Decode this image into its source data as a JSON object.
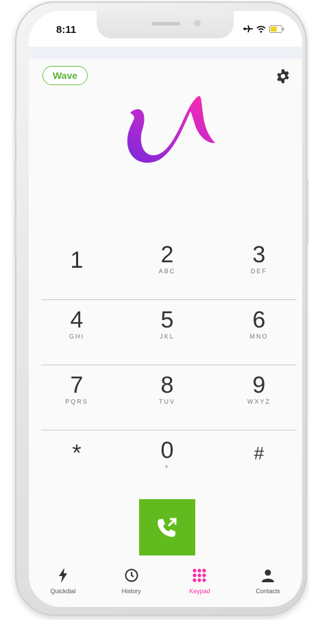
{
  "status_bar": {
    "time": "8:11"
  },
  "header": {
    "wave_button_label": "Wave"
  },
  "keypad": {
    "rows": [
      [
        {
          "digit": "1",
          "letters": ""
        },
        {
          "digit": "2",
          "letters": "ABC"
        },
        {
          "digit": "3",
          "letters": "DEF"
        }
      ],
      [
        {
          "digit": "4",
          "letters": "GHI"
        },
        {
          "digit": "5",
          "letters": "JKL"
        },
        {
          "digit": "6",
          "letters": "MNO"
        }
      ],
      [
        {
          "digit": "7",
          "letters": "PQRS"
        },
        {
          "digit": "8",
          "letters": "TUV"
        },
        {
          "digit": "9",
          "letters": "WXYZ"
        }
      ],
      [
        {
          "digit": "*",
          "letters": ""
        },
        {
          "digit": "0",
          "letters": "+"
        },
        {
          "digit": "#",
          "letters": ""
        }
      ]
    ]
  },
  "tabbar": {
    "items": [
      {
        "label": "Quickdial",
        "icon": "lightning-icon"
      },
      {
        "label": "History",
        "icon": "clock-icon"
      },
      {
        "label": "Keypad",
        "icon": "keypad-grid-icon",
        "active": true
      },
      {
        "label": "Contacts",
        "icon": "person-icon"
      }
    ]
  },
  "colors": {
    "accent_green": "#62bb1e",
    "active_tab_pink": "#ff2aa8",
    "logo_gradient_start": "#8a2be2",
    "logo_gradient_end": "#ff2aa8"
  }
}
